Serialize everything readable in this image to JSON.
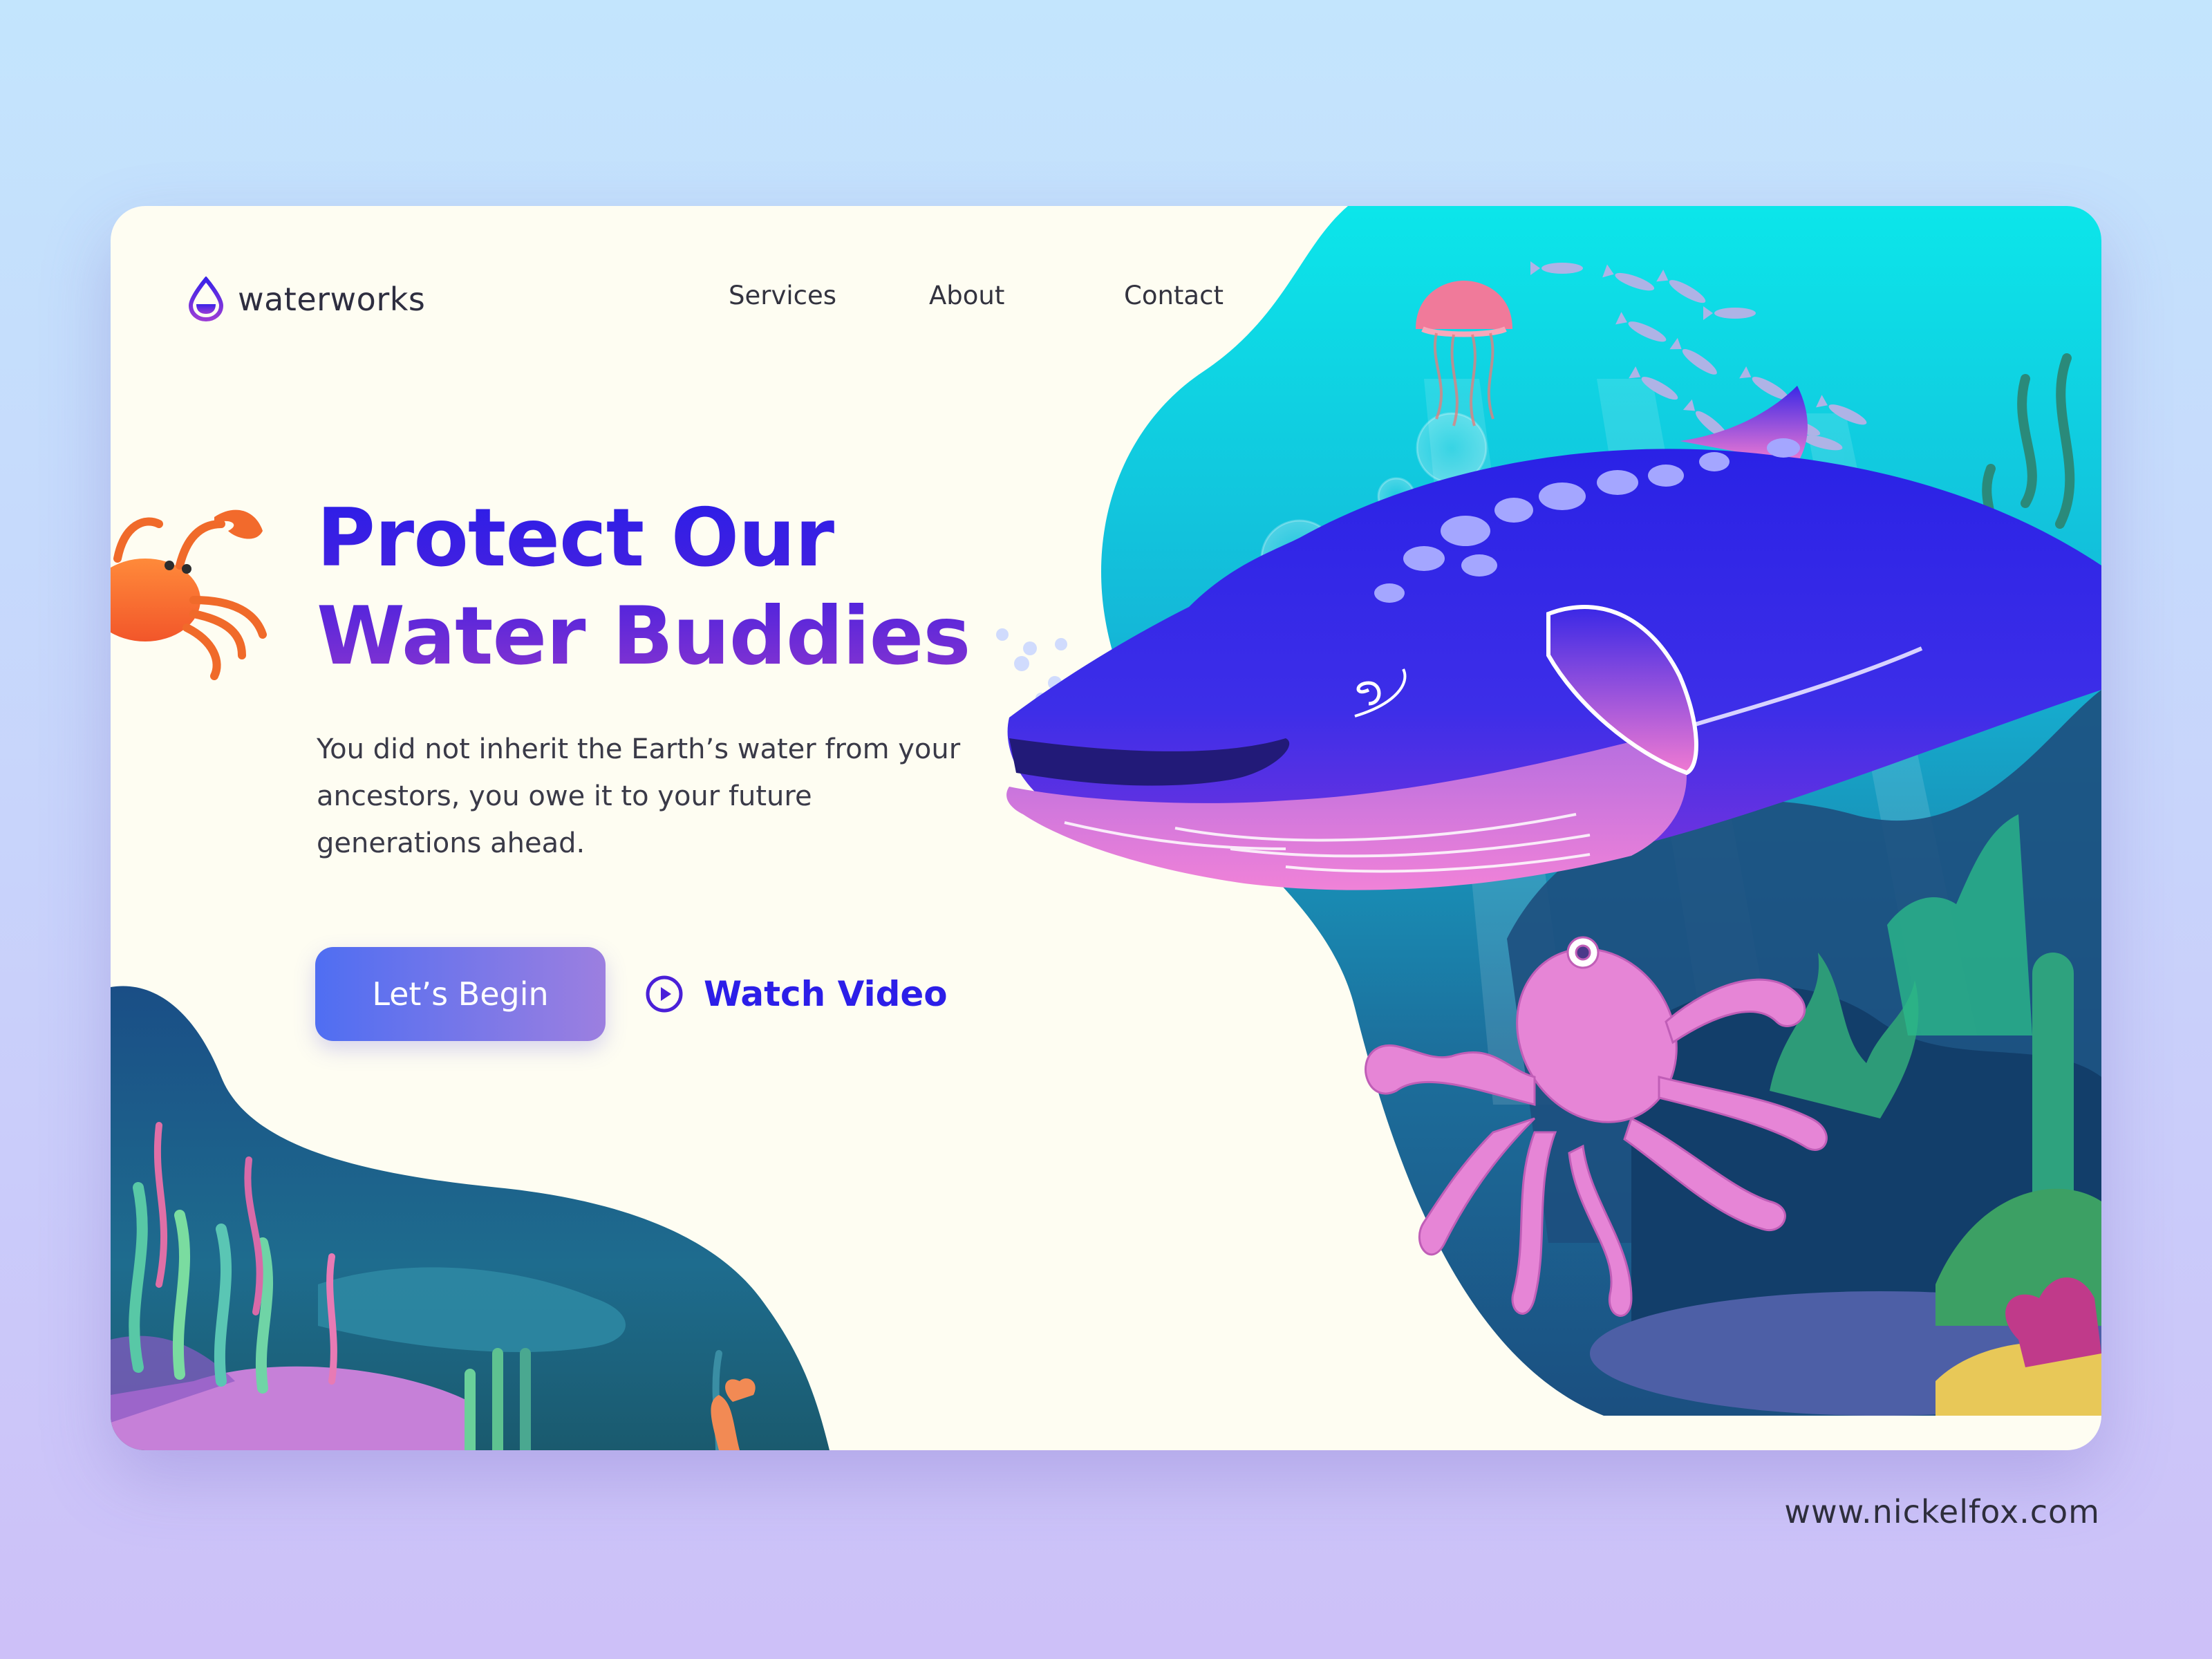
{
  "brand": {
    "name": "waterworks",
    "icon": "water-drop-icon"
  },
  "nav": {
    "items": [
      "Services",
      "About",
      "Contact"
    ]
  },
  "hero": {
    "title_line1": "Protect Our",
    "title_line2": "Water Buddies",
    "description": "You did not inherit the Earth’s water from your ancestors, you owe it to your future generations ahead.",
    "primary_button": "Let’s Begin",
    "secondary_button": "Watch Video",
    "secondary_icon": "play-circle-icon"
  },
  "illustration": {
    "characters": [
      "crab",
      "whale",
      "octopus",
      "jellyfish",
      "school-of-fish",
      "coral-reef"
    ]
  },
  "footer": {
    "url": "www.nickelfox.com"
  },
  "colors": {
    "page_bg_top": "#c3e5fd",
    "page_bg_bottom": "#cdc0f8",
    "card_bg": "#fefdf2",
    "title_blue": "#2a1ee8",
    "title_purple": "#8a35cf",
    "button_start": "#4f6ef2",
    "button_end": "#9c7fe0",
    "ocean_light": "#12d4e6",
    "ocean_deep": "#1d5a86"
  }
}
